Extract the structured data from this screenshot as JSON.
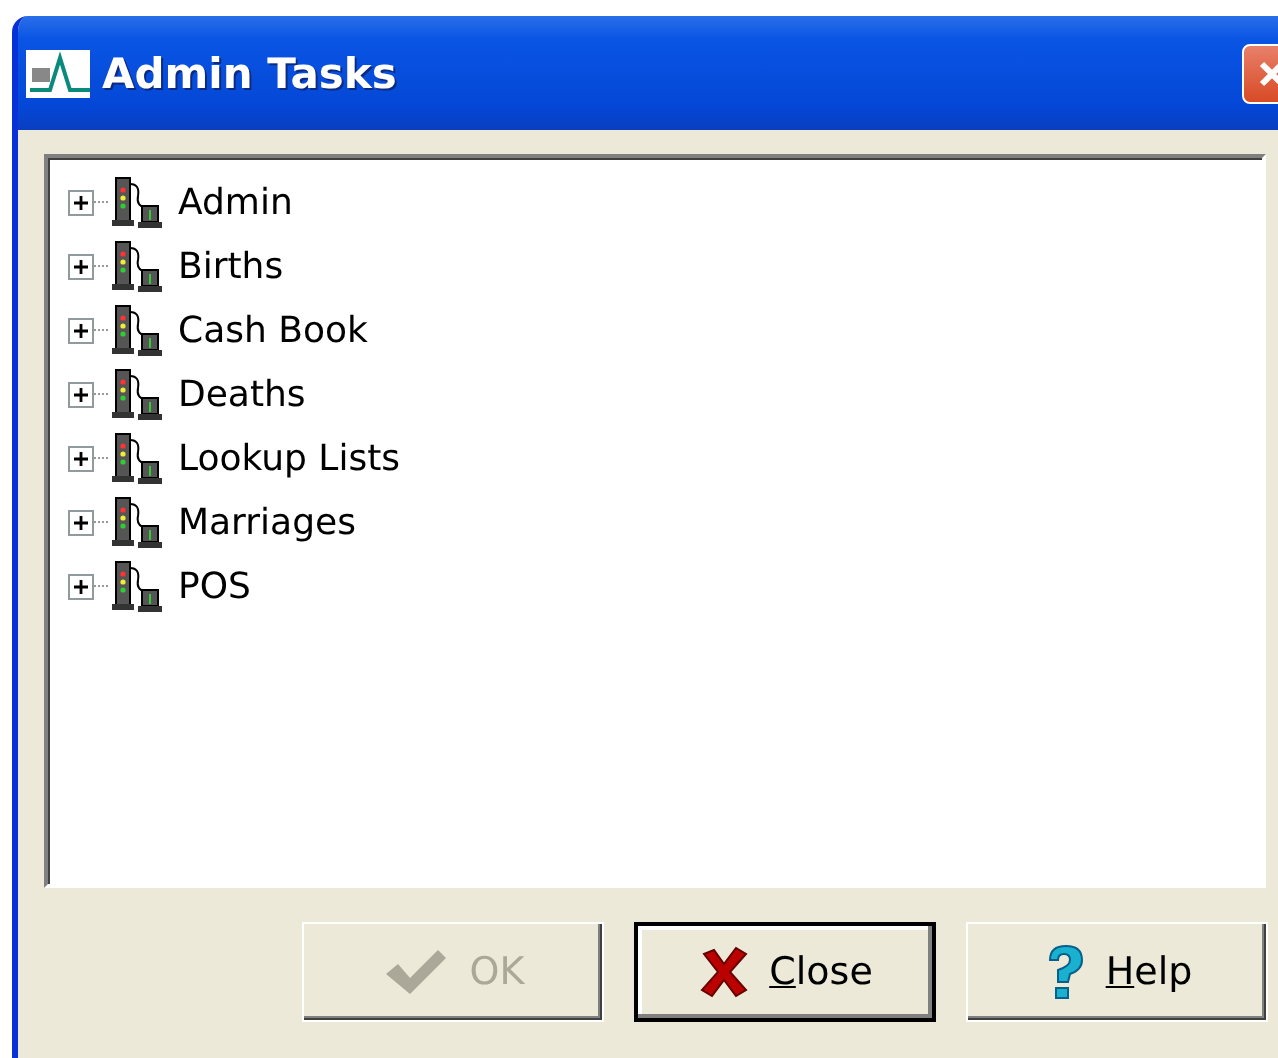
{
  "window": {
    "title": "Admin Tasks"
  },
  "tree": {
    "items": [
      {
        "label": "Admin",
        "expanded": false
      },
      {
        "label": "Births",
        "expanded": false
      },
      {
        "label": "Cash Book",
        "expanded": false
      },
      {
        "label": "Deaths",
        "expanded": false
      },
      {
        "label": "Lookup Lists",
        "expanded": false
      },
      {
        "label": "Marriages",
        "expanded": false
      },
      {
        "label": "POS",
        "expanded": false
      }
    ]
  },
  "buttons": [
    {
      "kind": "ok",
      "label": "OK",
      "disabled": true,
      "default": false,
      "mnemonic": false
    },
    {
      "kind": "close",
      "label": "Close",
      "disabled": false,
      "default": true,
      "mnemonic": true
    },
    {
      "kind": "help",
      "label": "Help",
      "disabled": false,
      "default": false,
      "mnemonic": true
    }
  ]
}
